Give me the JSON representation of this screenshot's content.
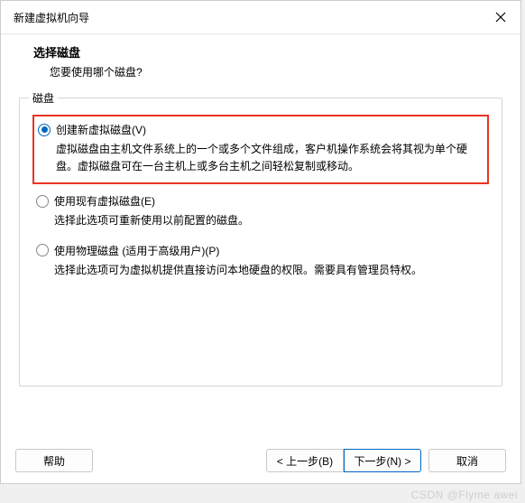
{
  "titlebar": {
    "title": "新建虚拟机向导"
  },
  "header": {
    "title": "选择磁盘",
    "subtitle": "您要使用哪个磁盘?"
  },
  "group": {
    "label": "磁盘",
    "options": [
      {
        "label": "创建新虚拟磁盘(V)",
        "desc": "虚拟磁盘由主机文件系统上的一个或多个文件组成，客户机操作系统会将其视为单个硬盘。虚拟磁盘可在一台主机上或多台主机之间轻松复制或移动。"
      },
      {
        "label": "使用现有虚拟磁盘(E)",
        "desc": "选择此选项可重新使用以前配置的磁盘。"
      },
      {
        "label": "使用物理磁盘 (适用于高级用户)(P)",
        "desc": "选择此选项可为虚拟机提供直接访问本地硬盘的权限。需要具有管理员特权。"
      }
    ]
  },
  "buttons": {
    "help": "帮助",
    "back": "< 上一步(B)",
    "next": "下一步(N) >",
    "cancel": "取消"
  },
  "watermark": "CSDN @Flyme awei"
}
